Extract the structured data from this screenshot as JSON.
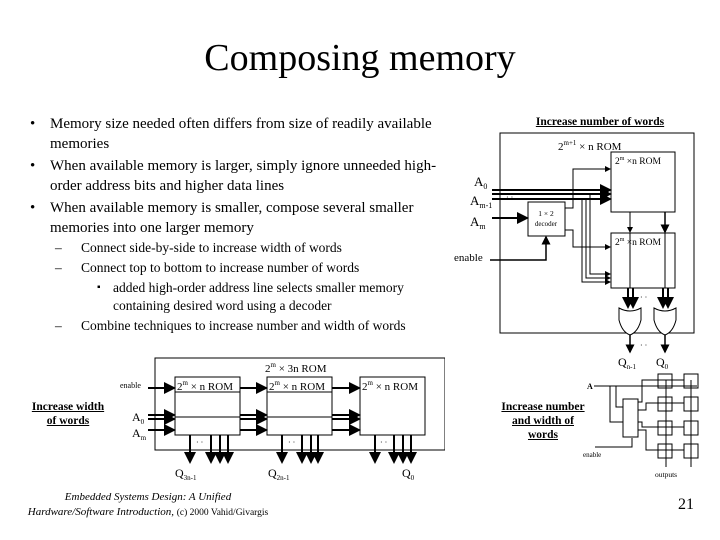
{
  "slide": {
    "title": "Composing memory",
    "page_number": "21",
    "accent_color": "#3b63e6",
    "footer": {
      "line1": "Embedded Systems Design: A Unified",
      "line2_italic": "Hardware/Software Introduction,",
      "line2_plain": "(c) 2000 Vahid/Givargis"
    }
  },
  "bullets": [
    {
      "marker": "•",
      "text": "Memory size needed often differs from size of readily available memories"
    },
    {
      "marker": "•",
      "text": "When available memory is larger, simply ignore unneeded high-order address bits and higher data lines"
    },
    {
      "marker": "•",
      "text": "When available memory is smaller, compose several smaller memories into one larger memory"
    }
  ],
  "sub_bullets": [
    {
      "marker": "–",
      "text": "Connect side-by-side to increase width of words"
    },
    {
      "marker": "–",
      "text": "Connect top to bottom to increase number of words"
    },
    {
      "marker": "▪",
      "text": "added high-order address line selects smaller memory containing desired word using a decoder"
    },
    {
      "marker": "–",
      "text": "Combine techniques to increase number and width of words"
    }
  ],
  "diagram_number": {
    "heading": "Increase number of words",
    "outer_label": "2^(m+1) × n ROM",
    "outer_base": "2",
    "outer_exp": "m+1",
    "outer_rest": " × n  ROM",
    "rom_base": "2",
    "rom_exp": "m",
    "rom_rest": " ×n  ROM",
    "decoder_line1": "1 × 2",
    "decoder_line2": "decoder",
    "inputs": {
      "a0": "A",
      "a0_sub": "0",
      "am1": "A",
      "am1_sub": "m-1",
      "am": "A",
      "am_sub": "m"
    },
    "enable": "enable",
    "ellipsis": "· ·",
    "outputs": {
      "qn1": "Q",
      "qn1_sub": "n-1",
      "q0": "Q",
      "q0_sub": "0"
    }
  },
  "diagram_width": {
    "heading_line1": "Increase width",
    "heading_line2": "of words",
    "outer_base": "2",
    "outer_exp": "m",
    "outer_rest": " × 3n  ROM",
    "rom_base": "2",
    "rom_exp": "m",
    "rom_rest": " × n  ROM",
    "enable": "enable",
    "inputs": {
      "a0": "A",
      "a0_sub": "0",
      "am": "A",
      "am_sub": "m"
    },
    "ellipsis": "· ·",
    "outputs": {
      "q3n1": "Q",
      "q3n1_sub": "3n-1",
      "q2n1": "Q",
      "q2n1_sub": "2n-1",
      "q0": "Q",
      "q0_sub": "0"
    }
  },
  "diagram_both": {
    "heading_line1": "Increase number",
    "heading_line2": "and width of",
    "heading_line3": "words",
    "input": "A",
    "enable": "enable",
    "outputs": "outputs"
  }
}
